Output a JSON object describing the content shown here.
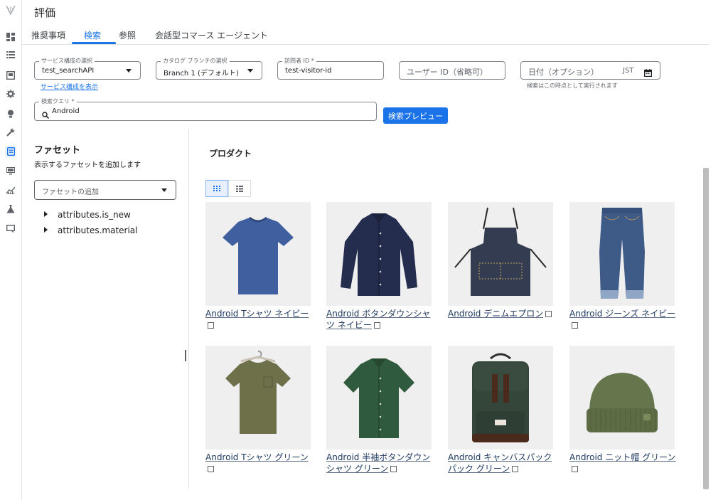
{
  "header": {
    "title": "評価"
  },
  "tabs": [
    {
      "label": "推奨事項",
      "active": false
    },
    {
      "label": "検索",
      "active": true
    },
    {
      "label": "参照",
      "active": false
    },
    {
      "label": "会話型コマース エージェント",
      "active": false
    }
  ],
  "form": {
    "service_config": {
      "label": "サービス構成の選択",
      "value": "test_searchAPI",
      "link": "サービス構成を表示"
    },
    "catalog_branch": {
      "label": "カタログ ブランチの選択",
      "value": "Branch 1 (デフォルト)"
    },
    "visitor_id": {
      "label": "訪問者 ID *",
      "value": "test-visitor-id"
    },
    "user_id": {
      "placeholder": "ユーザー ID（省略可）"
    },
    "date": {
      "placeholder": "日付（オプション）",
      "timezone": "JST",
      "hint": "検索はこの時点として実行されます"
    },
    "query": {
      "label": "検索クエリ *",
      "value": "Android"
    },
    "preview_button": "検索プレビュー"
  },
  "facets": {
    "title": "ファセット",
    "subtitle": "表示するファセットを追加します",
    "add_placeholder": "ファセットの追加",
    "items": [
      "attributes.is_new",
      "attributes.material"
    ]
  },
  "products": {
    "title": "プロダクト",
    "items": [
      {
        "title": "Android Tシャツ ネイビー",
        "kind": "tshirt",
        "color": "#3f5f9e"
      },
      {
        "title": "Android ボタンダウンシャツ ネイビー",
        "kind": "shirt",
        "color": "#252d4f"
      },
      {
        "title": "Android デニムエプロン",
        "kind": "apron",
        "color": "#343c52"
      },
      {
        "title": "Android ジーンズ ネイビー",
        "kind": "jeans",
        "color": "#3e5a86"
      },
      {
        "title": "Android Tシャツ グリーン",
        "kind": "tshirt-hanger",
        "color": "#6d7049"
      },
      {
        "title": "Android 半袖ボタンダウンシャツ グリーン",
        "kind": "shirt-short",
        "color": "#2f5a3d"
      },
      {
        "title": "Android キャンバスパックパック グリーン",
        "kind": "backpack",
        "color": "#34453a"
      },
      {
        "title": "Android ニット帽 グリーン",
        "kind": "beanie",
        "color": "#66764c"
      }
    ]
  }
}
